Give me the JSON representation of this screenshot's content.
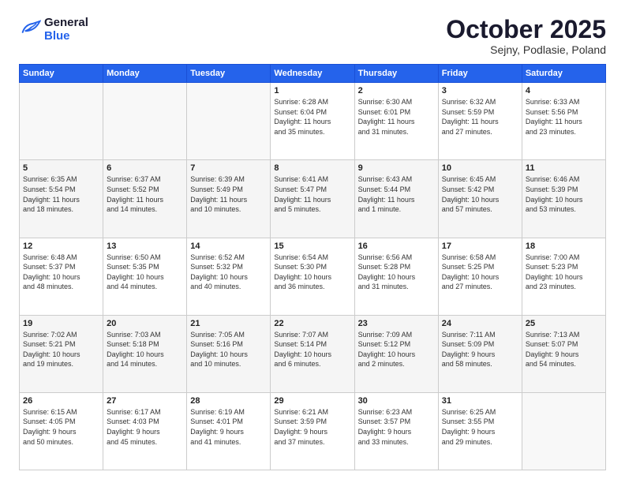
{
  "header": {
    "logo_line1": "General",
    "logo_line2": "Blue",
    "month": "October 2025",
    "location": "Sejny, Podlasie, Poland"
  },
  "weekdays": [
    "Sunday",
    "Monday",
    "Tuesday",
    "Wednesday",
    "Thursday",
    "Friday",
    "Saturday"
  ],
  "weeks": [
    [
      {
        "day": "",
        "info": "",
        "empty": true
      },
      {
        "day": "",
        "info": "",
        "empty": true
      },
      {
        "day": "",
        "info": "",
        "empty": true
      },
      {
        "day": "1",
        "info": "Sunrise: 6:28 AM\nSunset: 6:04 PM\nDaylight: 11 hours\nand 35 minutes."
      },
      {
        "day": "2",
        "info": "Sunrise: 6:30 AM\nSunset: 6:01 PM\nDaylight: 11 hours\nand 31 minutes."
      },
      {
        "day": "3",
        "info": "Sunrise: 6:32 AM\nSunset: 5:59 PM\nDaylight: 11 hours\nand 27 minutes."
      },
      {
        "day": "4",
        "info": "Sunrise: 6:33 AM\nSunset: 5:56 PM\nDaylight: 11 hours\nand 23 minutes."
      }
    ],
    [
      {
        "day": "5",
        "info": "Sunrise: 6:35 AM\nSunset: 5:54 PM\nDaylight: 11 hours\nand 18 minutes."
      },
      {
        "day": "6",
        "info": "Sunrise: 6:37 AM\nSunset: 5:52 PM\nDaylight: 11 hours\nand 14 minutes."
      },
      {
        "day": "7",
        "info": "Sunrise: 6:39 AM\nSunset: 5:49 PM\nDaylight: 11 hours\nand 10 minutes."
      },
      {
        "day": "8",
        "info": "Sunrise: 6:41 AM\nSunset: 5:47 PM\nDaylight: 11 hours\nand 5 minutes."
      },
      {
        "day": "9",
        "info": "Sunrise: 6:43 AM\nSunset: 5:44 PM\nDaylight: 11 hours\nand 1 minute."
      },
      {
        "day": "10",
        "info": "Sunrise: 6:45 AM\nSunset: 5:42 PM\nDaylight: 10 hours\nand 57 minutes."
      },
      {
        "day": "11",
        "info": "Sunrise: 6:46 AM\nSunset: 5:39 PM\nDaylight: 10 hours\nand 53 minutes."
      }
    ],
    [
      {
        "day": "12",
        "info": "Sunrise: 6:48 AM\nSunset: 5:37 PM\nDaylight: 10 hours\nand 48 minutes."
      },
      {
        "day": "13",
        "info": "Sunrise: 6:50 AM\nSunset: 5:35 PM\nDaylight: 10 hours\nand 44 minutes."
      },
      {
        "day": "14",
        "info": "Sunrise: 6:52 AM\nSunset: 5:32 PM\nDaylight: 10 hours\nand 40 minutes."
      },
      {
        "day": "15",
        "info": "Sunrise: 6:54 AM\nSunset: 5:30 PM\nDaylight: 10 hours\nand 36 minutes."
      },
      {
        "day": "16",
        "info": "Sunrise: 6:56 AM\nSunset: 5:28 PM\nDaylight: 10 hours\nand 31 minutes."
      },
      {
        "day": "17",
        "info": "Sunrise: 6:58 AM\nSunset: 5:25 PM\nDaylight: 10 hours\nand 27 minutes."
      },
      {
        "day": "18",
        "info": "Sunrise: 7:00 AM\nSunset: 5:23 PM\nDaylight: 10 hours\nand 23 minutes."
      }
    ],
    [
      {
        "day": "19",
        "info": "Sunrise: 7:02 AM\nSunset: 5:21 PM\nDaylight: 10 hours\nand 19 minutes."
      },
      {
        "day": "20",
        "info": "Sunrise: 7:03 AM\nSunset: 5:18 PM\nDaylight: 10 hours\nand 14 minutes."
      },
      {
        "day": "21",
        "info": "Sunrise: 7:05 AM\nSunset: 5:16 PM\nDaylight: 10 hours\nand 10 minutes."
      },
      {
        "day": "22",
        "info": "Sunrise: 7:07 AM\nSunset: 5:14 PM\nDaylight: 10 hours\nand 6 minutes."
      },
      {
        "day": "23",
        "info": "Sunrise: 7:09 AM\nSunset: 5:12 PM\nDaylight: 10 hours\nand 2 minutes."
      },
      {
        "day": "24",
        "info": "Sunrise: 7:11 AM\nSunset: 5:09 PM\nDaylight: 9 hours\nand 58 minutes."
      },
      {
        "day": "25",
        "info": "Sunrise: 7:13 AM\nSunset: 5:07 PM\nDaylight: 9 hours\nand 54 minutes."
      }
    ],
    [
      {
        "day": "26",
        "info": "Sunrise: 6:15 AM\nSunset: 4:05 PM\nDaylight: 9 hours\nand 50 minutes."
      },
      {
        "day": "27",
        "info": "Sunrise: 6:17 AM\nSunset: 4:03 PM\nDaylight: 9 hours\nand 45 minutes."
      },
      {
        "day": "28",
        "info": "Sunrise: 6:19 AM\nSunset: 4:01 PM\nDaylight: 9 hours\nand 41 minutes."
      },
      {
        "day": "29",
        "info": "Sunrise: 6:21 AM\nSunset: 3:59 PM\nDaylight: 9 hours\nand 37 minutes."
      },
      {
        "day": "30",
        "info": "Sunrise: 6:23 AM\nSunset: 3:57 PM\nDaylight: 9 hours\nand 33 minutes."
      },
      {
        "day": "31",
        "info": "Sunrise: 6:25 AM\nSunset: 3:55 PM\nDaylight: 9 hours\nand 29 minutes."
      },
      {
        "day": "",
        "info": "",
        "empty": true
      }
    ]
  ]
}
